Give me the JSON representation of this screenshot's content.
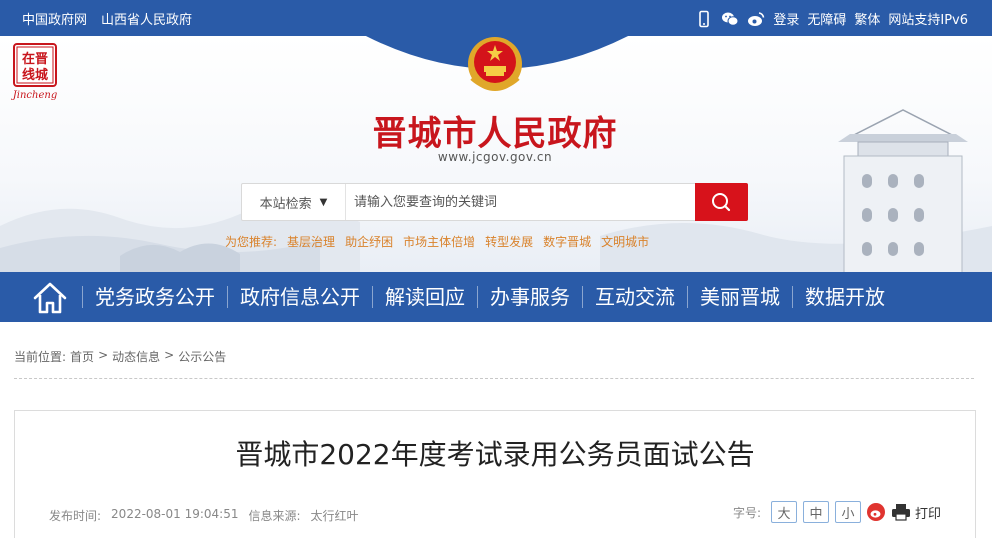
{
  "topbar": {
    "links_left": [
      "中国政府网",
      "山西省人民政府"
    ],
    "login": "登录",
    "accessibility": "无障碍",
    "traditional": "繁体",
    "ipv6": "网站支持IPv6"
  },
  "header": {
    "logo_text": [
      "在晋",
      "线城"
    ],
    "logo_caption": "Jincheng",
    "title": "晋城市人民政府",
    "url": "www.jcgov.gov.cn"
  },
  "search": {
    "scope_label": "本站检索",
    "placeholder": "请输入您要查询的关键词"
  },
  "recommend": {
    "label": "为您推荐:",
    "items": [
      "基层治理",
      "助企纾困",
      "市场主体倍增",
      "转型发展",
      "数字晋城",
      "文明城市"
    ]
  },
  "nav": {
    "items": [
      "党务政务公开",
      "政府信息公开",
      "解读回应",
      "办事服务",
      "互动交流",
      "美丽晋城",
      "数据开放"
    ]
  },
  "breadcrumb": {
    "label": "当前位置:",
    "items": [
      "首页",
      "动态信息",
      "公示公告"
    ],
    "separator": ">"
  },
  "article": {
    "title": "晋城市2022年度考试录用公务员面试公告",
    "publish_label": "发布时间:",
    "publish_time": "2022-08-01 19:04:51",
    "source_label": "信息来源:",
    "source": "太行红叶",
    "font_label": "字号:",
    "font_large": "大",
    "font_medium": "中",
    "font_small": "小",
    "print": "打印"
  },
  "colors": {
    "primary_blue": "#2a5ba8",
    "title_red": "#c8161d",
    "search_red": "#d7121b",
    "recommend_orange": "#d9822b"
  }
}
